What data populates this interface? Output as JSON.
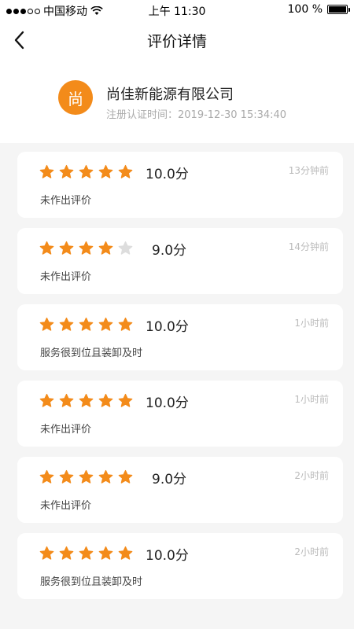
{
  "status_bar": {
    "carrier": "中国移动",
    "time": "上午 11:30",
    "battery_percent": "100 %",
    "battery_level": 1.0,
    "signal_bars_filled": 3,
    "signal_bars_total": 5
  },
  "nav": {
    "title": "评价详情",
    "back_icon": "chevron-left-icon"
  },
  "company": {
    "avatar_char": "尚",
    "avatar_color": "#f38b1a",
    "name": "尚佳新能源有限公司",
    "register_time": "注册认证时间：2019-12-30 15:34:40"
  },
  "colors": {
    "star_filled": "#f38b1a",
    "star_empty": "#dddddd"
  },
  "reviews": [
    {
      "rating": 5,
      "score": "10.0分",
      "time": "13分钟前",
      "comment": "未作出评价"
    },
    {
      "rating": 4,
      "score": "9.0分",
      "time": "14分钟前",
      "comment": "未作出评价"
    },
    {
      "rating": 5,
      "score": "10.0分",
      "time": "1小时前",
      "comment": "服务很到位且装卸及时"
    },
    {
      "rating": 5,
      "score": "10.0分",
      "time": "1小时前",
      "comment": "未作出评价"
    },
    {
      "rating": 5,
      "score": "9.0分",
      "time": "2小时前",
      "comment": "未作出评价"
    },
    {
      "rating": 5,
      "score": "10.0分",
      "time": "2小时前",
      "comment": "服务很到位且装卸及时"
    }
  ]
}
